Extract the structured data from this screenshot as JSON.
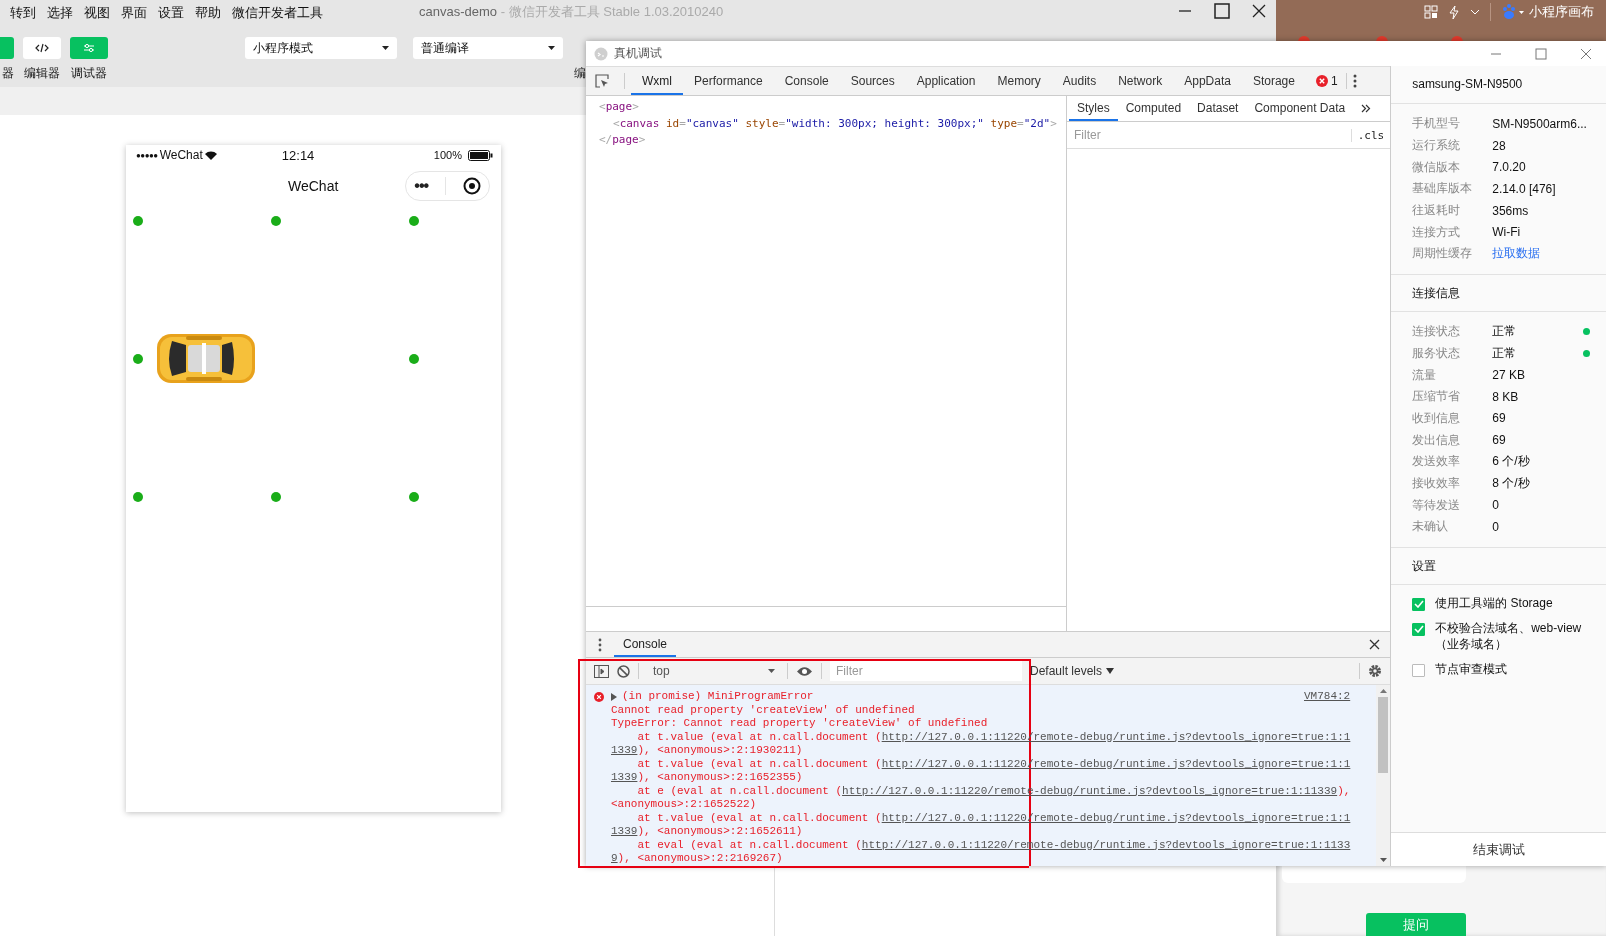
{
  "ide": {
    "menu": [
      "转到",
      "选择",
      "视图",
      "界面",
      "设置",
      "帮助",
      "微信开发者工具"
    ],
    "project": "canvas-demo",
    "title_suffix": "- 微信开发者工具 Stable 1.03.2010240",
    "toolbar": [
      {
        "label": "器",
        "kind": "simulator",
        "on": true
      },
      {
        "label": "编辑器",
        "kind": "editor",
        "on": false
      },
      {
        "label": "调试器",
        "kind": "debugger",
        "on": true
      }
    ],
    "mode_select": "小程序模式",
    "compile_select": "普通编译",
    "cut_label": "编"
  },
  "browser_strip": {
    "text": "小程序画布"
  },
  "behind_panel": {
    "button": "提问"
  },
  "simulator": {
    "signal": "●●●●●",
    "carrier": "WeChat",
    "time": "12:14",
    "battery": "100%",
    "nav_title": "WeChat",
    "capsule_more": "•••"
  },
  "devtools": {
    "title": "真机调试",
    "tabs": [
      {
        "label": "Wxml",
        "selected": true
      },
      {
        "label": "Performance",
        "selected": false
      },
      {
        "label": "Console",
        "selected": false
      },
      {
        "label": "Sources",
        "selected": false
      },
      {
        "label": "Application",
        "selected": false
      },
      {
        "label": "Memory",
        "selected": false
      },
      {
        "label": "Audits",
        "selected": false
      },
      {
        "label": "Network",
        "selected": false
      },
      {
        "label": "AppData",
        "selected": false
      },
      {
        "label": "Storage",
        "selected": false
      }
    ],
    "error_count": "1",
    "wxml": [
      {
        "tokens": [
          {
            "text": "<",
            "kind": "punct"
          },
          {
            "text": "page",
            "kind": "tag"
          },
          {
            "text": ">",
            "kind": "punct"
          }
        ],
        "children": [
          {
            "tokens": [
              {
                "text": "<",
                "kind": "punct"
              },
              {
                "text": "canvas",
                "kind": "tag"
              },
              {
                "text": " id",
                "kind": "attr"
              },
              {
                "text": "=",
                "kind": "punct"
              },
              {
                "text": "\"canvas\"",
                "kind": "value"
              },
              {
                "text": " style",
                "kind": "attr"
              },
              {
                "text": "=",
                "kind": "punct"
              },
              {
                "text": "\"width: 300px; height: 300px;\"",
                "kind": "value"
              },
              {
                "text": " type",
                "kind": "attr"
              },
              {
                "text": "=",
                "kind": "punct"
              },
              {
                "text": "\"2d\"",
                "kind": "value"
              },
              {
                "text": ">",
                "kind": "punct"
              }
            ]
          }
        ]
      },
      {
        "tokens": [
          {
            "text": "</",
            "kind": "punct"
          },
          {
            "text": "page",
            "kind": "tag"
          },
          {
            "text": ">",
            "kind": "punct"
          }
        ]
      }
    ],
    "style_tabs": [
      {
        "label": "Styles",
        "selected": true
      },
      {
        "label": "Computed",
        "selected": false
      },
      {
        "label": "Dataset",
        "selected": false
      },
      {
        "label": "Component Data",
        "selected": false
      }
    ],
    "styles_filter": {
      "placeholder": "Filter"
    },
    "cls": ".cls",
    "console": {
      "tab": {
        "label": "Console",
        "selected": true
      },
      "context": "top",
      "filter": {
        "placeholder": "Filter"
      },
      "levels": "Default levels",
      "message": {
        "source": "VM784:2",
        "summary": "(in promise) MiniProgramError",
        "lines": [
          [
            {
              "text": "Cannot read property 'createView' of undefined"
            }
          ],
          [
            {
              "text": "TypeError: Cannot read property 'createView' of undefined"
            }
          ],
          [
            {
              "text": "    at t.value (eval at n.call.document ("
            },
            {
              "text": "http://127.0.0.1:11220/remote-debug/runtime.js?devtools_ignore=true:1:1",
              "link": true
            }
          ],
          [
            {
              "text": "1339",
              "link": true
            },
            {
              "text": "), <anonymous>:2:1930211)"
            }
          ],
          [
            {
              "text": "    at t.value (eval at n.call.document ("
            },
            {
              "text": "http://127.0.0.1:11220/remote-debug/runtime.js?devtools_ignore=true:1:1",
              "link": true
            }
          ],
          [
            {
              "text": "1339",
              "link": true
            },
            {
              "text": "), <anonymous>:2:1652355)"
            }
          ],
          [
            {
              "text": "    at e (eval at n.call.document ("
            },
            {
              "text": "http://127.0.0.1:11220/remote-debug/runtime.js?devtools_ignore=true:1:11339",
              "link": true
            },
            {
              "text": "),"
            }
          ],
          [
            {
              "text": "<anonymous>:2:1652522)"
            }
          ],
          [
            {
              "text": "    at t.value (eval at n.call.document ("
            },
            {
              "text": "http://127.0.0.1:11220/remote-debug/runtime.js?devtools_ignore=true:1:1",
              "link": true
            }
          ],
          [
            {
              "text": "1339",
              "link": true
            },
            {
              "text": "), <anonymous>:2:1652611)"
            }
          ],
          [
            {
              "text": "    at eval (eval at n.call.document ("
            },
            {
              "text": "http://127.0.0.1:11220/remote-debug/runtime.js?devtools_ignore=true:1:1133",
              "link": true
            }
          ],
          [
            {
              "text": "9",
              "link": true
            },
            {
              "text": "), <anonymous>:2:2169267)"
            }
          ]
        ]
      }
    },
    "device": {
      "name": "samsung-SM-N9500",
      "info": [
        {
          "label": "手机型号",
          "value": "SM-N9500arm6...",
          "kind": "text"
        },
        {
          "label": "运行系统",
          "value": "28",
          "kind": "text"
        },
        {
          "label": "微信版本",
          "value": "7.0.20",
          "kind": "text"
        },
        {
          "label": "基础库版本",
          "value": "2.14.0 [476]",
          "kind": "text"
        },
        {
          "label": "往返耗时",
          "value": "356ms",
          "kind": "text"
        },
        {
          "label": "连接方式",
          "value": "Wi-Fi",
          "kind": "text"
        },
        {
          "label": "周期性缓存",
          "value": "拉取数据",
          "kind": "link"
        }
      ],
      "connection_title": "连接信息",
      "connection": [
        {
          "label": "连接状态",
          "value": "正常",
          "color": "#07c160"
        },
        {
          "label": "服务状态",
          "value": "正常",
          "color": "#07c160"
        },
        {
          "label": "流量",
          "value": "27 KB"
        },
        {
          "label": "压缩节省",
          "value": "8 KB"
        },
        {
          "label": "收到信息",
          "value": "69"
        },
        {
          "label": "发出信息",
          "value": "69"
        },
        {
          "label": "发送效率",
          "value": "6 个/秒"
        },
        {
          "label": "接收效率",
          "value": "8 个/秒"
        },
        {
          "label": "等待发送",
          "value": "0"
        },
        {
          "label": "未确认",
          "value": "0"
        }
      ],
      "settings_title": "设置",
      "settings": [
        {
          "label": "使用工具端的 Storage",
          "checked": true
        },
        {
          "label": "不校验合法域名、web-view（业务域名）",
          "checked": true
        },
        {
          "label": "节点审查模式",
          "checked": false
        }
      ],
      "end_button": "结束调试"
    }
  }
}
